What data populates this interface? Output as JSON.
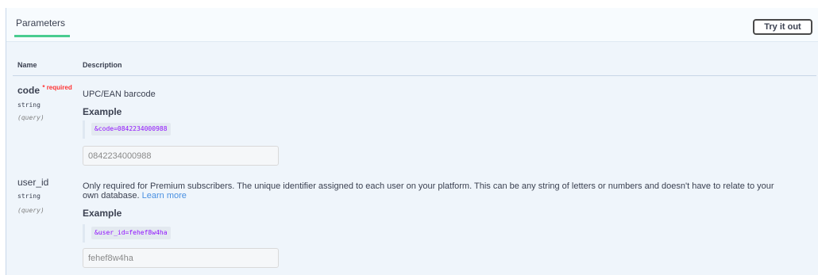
{
  "header": {
    "tab_label": "Parameters",
    "try_button_label": "Try it out"
  },
  "columns": {
    "name": "Name",
    "description": "Description"
  },
  "params": [
    {
      "name": "code",
      "required_marker": "* required",
      "type": "string",
      "location": "(query)",
      "description": "UPC/EAN barcode",
      "example_label": "Example",
      "example_code": "&code=0842234000988",
      "input_value": "0842234000988"
    },
    {
      "name": "user_id",
      "type": "string",
      "location": "(query)",
      "description_strong": "Only required for Premium subscribers.",
      "description_line1": " The unique identifier assigned to each user on your platform. This can be any string of letters or numbers and doesn't have to relate to your",
      "description_line2": "own database. ",
      "learn_more": "Learn more",
      "example_label": "Example",
      "example_code": "&user_id=fehef8w4ha",
      "input_value": "fehef8w4ha"
    }
  ],
  "colors": {
    "panel_bg": "#eff5fb",
    "tab_underline": "#49cc90",
    "required": "#ff3333",
    "example_code": "#9012fe",
    "link": "#4990e2"
  }
}
